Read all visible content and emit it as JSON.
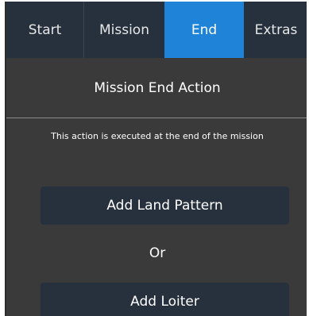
{
  "tabs": [
    {
      "label": "Start",
      "active": false
    },
    {
      "label": "Mission",
      "active": false
    },
    {
      "label": "End",
      "active": true
    },
    {
      "label": "Extras",
      "active": false
    }
  ],
  "section": {
    "title": "Mission End Action",
    "description": "This action is executed at the end of the mission"
  },
  "actions": {
    "land_label": "Add Land Pattern",
    "or_label": "Or",
    "loiter_label": "Add Loiter"
  },
  "colors": {
    "background": "#3a3a3a",
    "tab_bar": "#27313d",
    "active_tab": "#1f84d8",
    "button": "#27313d",
    "text": "#ffffff"
  }
}
